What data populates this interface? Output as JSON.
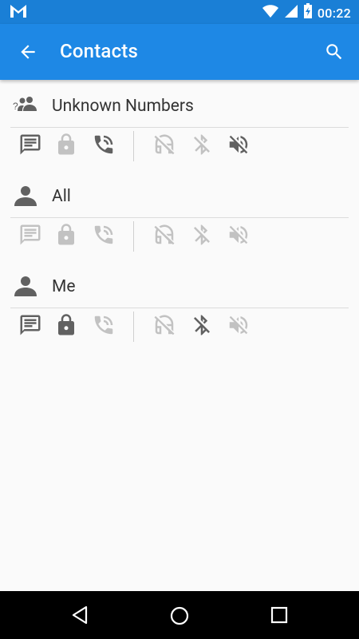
{
  "status_bar": {
    "time": "00:22",
    "notification_icon": "gmail-icon"
  },
  "app_bar": {
    "title": "Contacts",
    "back_icon": "arrow-back-icon",
    "search_icon": "search-icon"
  },
  "colors": {
    "primary": "#1e88e5",
    "status": "#1a7fd6",
    "icon_active": "#616161",
    "icon_inactive": "#c2c2c2"
  },
  "sections": [
    {
      "label": "Unknown Numbers",
      "icon": "unknown-group-icon",
      "toggles": {
        "message": "active",
        "lock": "inactive",
        "call": "active",
        "headset": "inactive",
        "bluetooth": "inactive",
        "mute": "active"
      }
    },
    {
      "label": "All",
      "icon": "person-icon",
      "toggles": {
        "message": "inactive",
        "lock": "inactive",
        "call": "inactive",
        "headset": "inactive",
        "bluetooth": "inactive",
        "mute": "inactive"
      }
    },
    {
      "label": "Me",
      "icon": "person-icon",
      "toggles": {
        "message": "active",
        "lock": "active",
        "call": "inactive",
        "headset": "inactive",
        "bluetooth": "active",
        "mute": "inactive"
      }
    }
  ],
  "nav_bar": {
    "back": "nav-back-icon",
    "home": "nav-home-icon",
    "recents": "nav-recents-icon"
  }
}
